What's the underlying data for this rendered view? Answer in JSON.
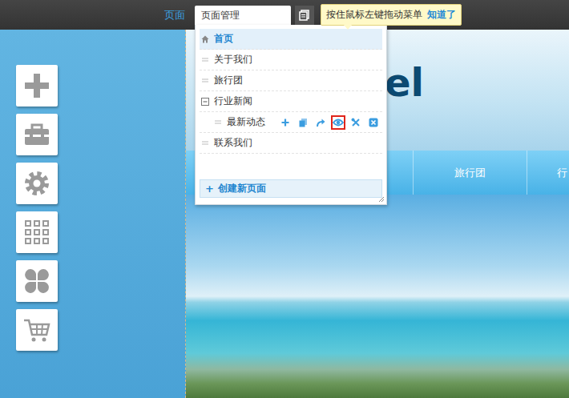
{
  "topbar": {
    "section": "页面",
    "dropdown": "页面管理",
    "tooltip": {
      "text": "按住鼠标左键拖动菜单",
      "action": "知道了"
    }
  },
  "page_menu": {
    "items": [
      {
        "label": "首页",
        "kind": "home",
        "selected": true
      },
      {
        "label": "关于我们",
        "kind": "page",
        "selected": false
      },
      {
        "label": "旅行团",
        "kind": "page",
        "selected": false
      },
      {
        "label": "行业新闻",
        "kind": "folder",
        "selected": false,
        "expanded": true,
        "children": [
          {
            "label": "最新动态",
            "kind": "page",
            "selected": false,
            "actions": [
              {
                "kind": "add",
                "selected": false
              },
              {
                "kind": "copy",
                "selected": false
              },
              {
                "kind": "redirect",
                "selected": false
              },
              {
                "kind": "preview",
                "selected": true
              },
              {
                "kind": "settings",
                "selected": false
              },
              {
                "kind": "delete",
                "selected": false
              }
            ]
          }
        ]
      },
      {
        "label": "联系我们",
        "kind": "page",
        "selected": false
      }
    ],
    "create_button": {
      "icon": "+",
      "label": "创建新页面"
    }
  },
  "preview": {
    "logo": "el",
    "nav": [
      {
        "label": "旅行团"
      },
      {
        "label": "行"
      }
    ]
  }
}
